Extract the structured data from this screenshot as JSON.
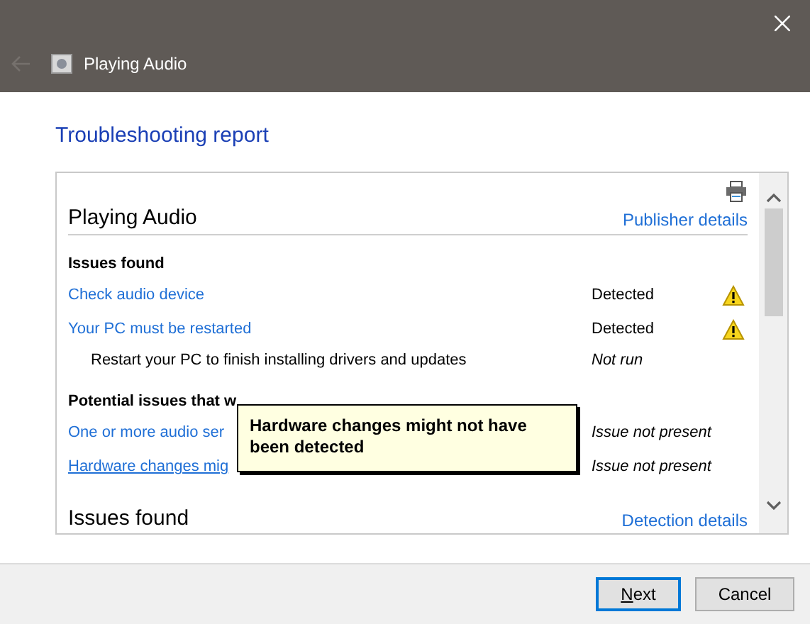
{
  "window": {
    "title": "Playing Audio",
    "back_disabled": true
  },
  "heading": "Troubleshooting report",
  "report": {
    "title": "Playing Audio",
    "publisher_link": "Publisher details",
    "sections": [
      {
        "heading": "Issues found",
        "rows": [
          {
            "kind": "link",
            "label": "Check audio device",
            "status": "Detected",
            "italic": false,
            "warning": true,
            "hovered": false
          },
          {
            "kind": "link",
            "label": "Your PC must be restarted",
            "status": "Detected",
            "italic": false,
            "warning": true,
            "hovered": false
          },
          {
            "kind": "detail",
            "label": "Restart your PC to finish installing drivers and updates",
            "status": "Not run",
            "italic": true,
            "warning": false
          }
        ]
      },
      {
        "heading": "Potential issues that w",
        "rows": [
          {
            "kind": "link",
            "label": "One or more audio ser",
            "status": "Issue not present",
            "italic": true,
            "warning": false,
            "hovered": false
          },
          {
            "kind": "link",
            "label": "Hardware changes mig",
            "status": "Issue not present",
            "italic": true,
            "warning": false,
            "hovered": true
          }
        ]
      }
    ],
    "next_heading": "Issues found",
    "next_link": "Detection details"
  },
  "tooltip": "Hardware changes might not have been detected",
  "buttons": [
    {
      "label": "Next",
      "default": true
    },
    {
      "label": "Cancel",
      "default": false
    }
  ]
}
